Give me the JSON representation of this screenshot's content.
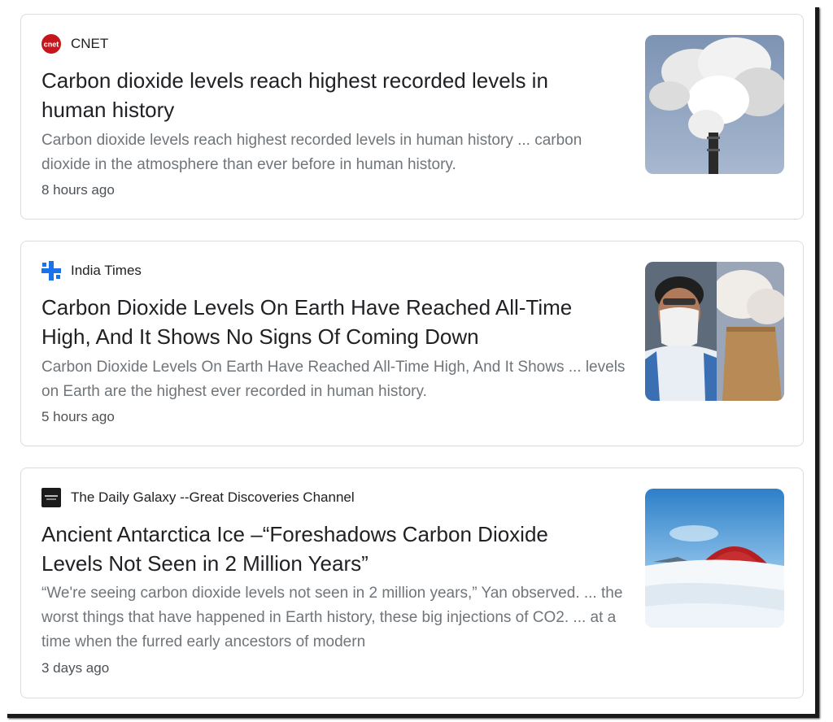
{
  "results": [
    {
      "source": "CNET",
      "favicon": "cnet-logo-icon",
      "headline": "Carbon dioxide levels reach highest recorded levels in human history",
      "snippet": "Carbon dioxide levels reach highest recorded levels in human history ... carbon dioxide in the atmosphere than ever before in human history.",
      "time": "8 hours ago",
      "thumbnail": "smokestack-image"
    },
    {
      "source": "India Times",
      "favicon": "india-times-logo-icon",
      "headline": "Carbon Dioxide Levels On Earth Have Reached All-Time High, And It Shows No Signs Of Coming Down",
      "snippet": "Carbon Dioxide Levels On Earth Have Reached All-Time High, And It Shows ... levels on Earth are the highest ever recorded in human history.",
      "time": "5 hours ago",
      "thumbnail": "masked-boy-cooling-tower-image"
    },
    {
      "source": "The Daily Galaxy --Great Discoveries Channel",
      "favicon": "daily-galaxy-logo-icon",
      "headline": "Ancient Antarctica Ice –“Foreshadows Carbon Dioxide Levels Not Seen in 2 Million Years”",
      "snippet": "“We're seeing carbon dioxide levels not seen in 2 million years,” Yan observed. ... the worst things that have happened in Earth history, these big injections of CO2. ... at a time when the furred early ancestors of modern",
      "time": "3 days ago",
      "thumbnail": "antarctica-dome-image"
    }
  ],
  "colors": {
    "title": "#202124",
    "snippet": "#70757a",
    "time": "#4d5156",
    "card_border": "#dadce0",
    "cnet_red": "#c4161c",
    "india_times_blue": "#1a73e8"
  }
}
